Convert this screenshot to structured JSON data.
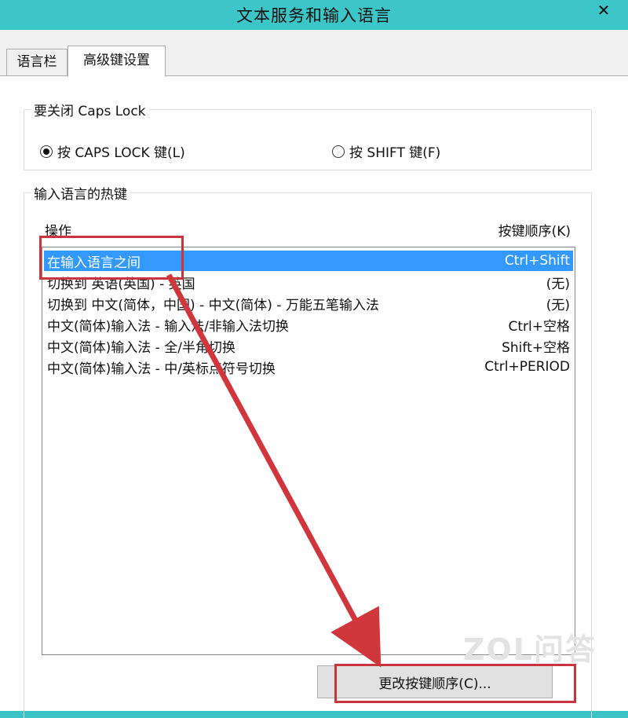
{
  "window": {
    "title": "文本服务和输入语言",
    "close_glyph": "✕"
  },
  "tabs": [
    {
      "label": "语言栏"
    },
    {
      "label": "高级键设置",
      "selected": true
    }
  ],
  "caps_lock": {
    "legend": "要关闭 Caps Lock",
    "options": [
      {
        "label": "按 CAPS LOCK 键(L)",
        "checked": true
      },
      {
        "label": "按 SHIFT 键(F)",
        "checked": false
      }
    ]
  },
  "hotkeys": {
    "legend": "输入语言的热键",
    "col_action": "操作",
    "col_keys": "按键顺序(K)",
    "rows": [
      {
        "action": "在输入语言之间",
        "keys": "Ctrl+Shift",
        "selected": true
      },
      {
        "action": "切换到 英语(英国) - 英国",
        "keys": "(无)"
      },
      {
        "action": "切换到 中文(简体，中国) - 中文(简体) - 万能五笔输入法",
        "keys": "(无)"
      },
      {
        "action": "中文(简体)输入法 - 输入法/非输入法切换",
        "keys": "Ctrl+空格"
      },
      {
        "action": "中文(简体)输入法 - 全/半角切换",
        "keys": "Shift+空格"
      },
      {
        "action": "中文(简体)输入法 - 中/英标点符号切换",
        "keys": "Ctrl+PERIOD"
      }
    ],
    "change_button": "更改按键顺序(C)..."
  },
  "watermark": "ZOL问答",
  "colors": {
    "titlebar": "#3cc6c8",
    "selection": "#3399ff",
    "annotation": "#c8353b"
  }
}
